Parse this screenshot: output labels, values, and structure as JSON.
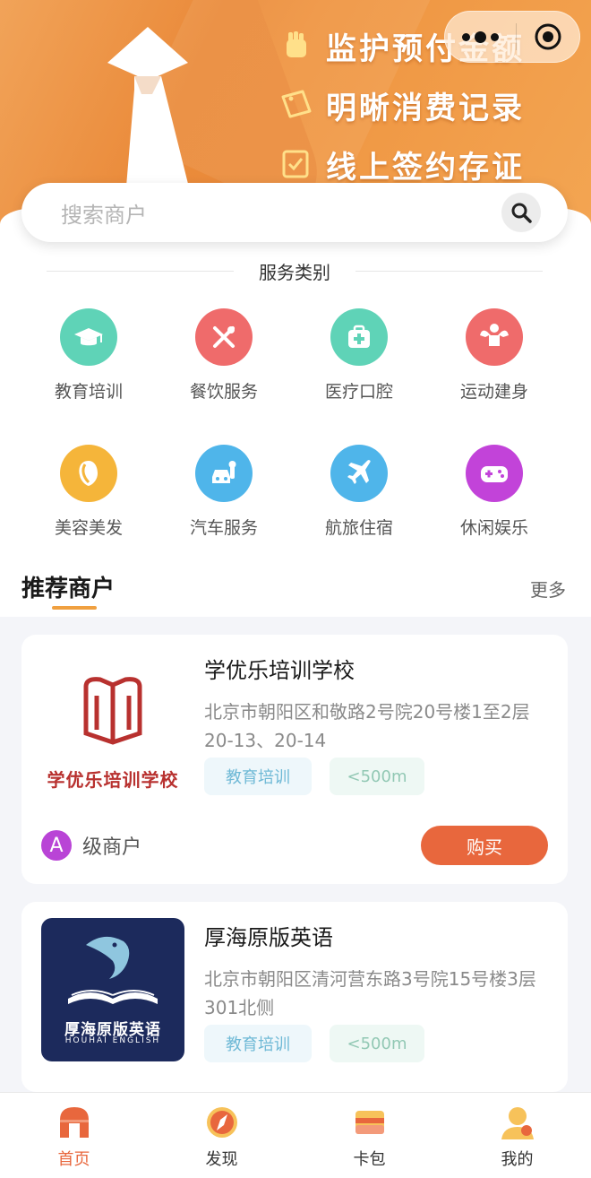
{
  "banner": {
    "slogans": [
      {
        "icon": "fist-icon",
        "text": "监护预付金额"
      },
      {
        "icon": "ticket-icon",
        "text": "明晰消费记录"
      },
      {
        "icon": "contract-icon",
        "text": "线上签约存证"
      }
    ]
  },
  "capsule": {
    "more_icon": "more-dots-icon",
    "close_icon": "target-icon"
  },
  "search": {
    "placeholder": "搜索商户",
    "icon": "search-icon"
  },
  "services": {
    "title": "服务类别",
    "items": [
      {
        "label": "教育培训",
        "icon": "graduation-cap-icon",
        "color": "#5fd3b7"
      },
      {
        "label": "餐饮服务",
        "icon": "fork-knife-icon",
        "color": "#ef6b6b"
      },
      {
        "label": "医疗口腔",
        "icon": "medical-kit-icon",
        "color": "#5fd3b7"
      },
      {
        "label": "运动建身",
        "icon": "muscle-icon",
        "color": "#ef6b6b"
      },
      {
        "label": "美容美发",
        "icon": "beauty-face-icon",
        "color": "#f5b53a"
      },
      {
        "label": "汽车服务",
        "icon": "car-wrench-icon",
        "color": "#4fb5ea"
      },
      {
        "label": "航旅住宿",
        "icon": "airplane-icon",
        "color": "#4fb5ea"
      },
      {
        "label": "休闲娱乐",
        "icon": "gamepad-icon",
        "color": "#c243d9"
      }
    ]
  },
  "recommend": {
    "title": "推荐商户",
    "more": "更多",
    "merchants": [
      {
        "name": "学优乐培训学校",
        "address": "北京市朝阳区和敬路2号院20号楼1至2层20-13、20-14",
        "logo_text": "学优乐培训学校",
        "tags": [
          "教育培训",
          "<500m"
        ],
        "level_badge": "A",
        "level_text": "级商户",
        "buy_label": "购买"
      },
      {
        "name": "厚海原版英语",
        "address": "北京市朝阳区清河营东路3号院15号楼3层301北侧",
        "logo_text": "厚海原版英语",
        "logo_subtext": "HOUHAI ENGLISH",
        "tags": [
          "教育培训",
          "<500m"
        ]
      }
    ]
  },
  "tabbar": {
    "tabs": [
      {
        "label": "首页",
        "icon": "home-icon",
        "active": true
      },
      {
        "label": "发现",
        "icon": "discover-icon",
        "active": false
      },
      {
        "label": "卡包",
        "icon": "wallet-icon",
        "active": false
      },
      {
        "label": "我的",
        "icon": "profile-icon",
        "active": false
      }
    ]
  },
  "colors": {
    "accent": "#e8673d",
    "banner": "#ef9440"
  }
}
